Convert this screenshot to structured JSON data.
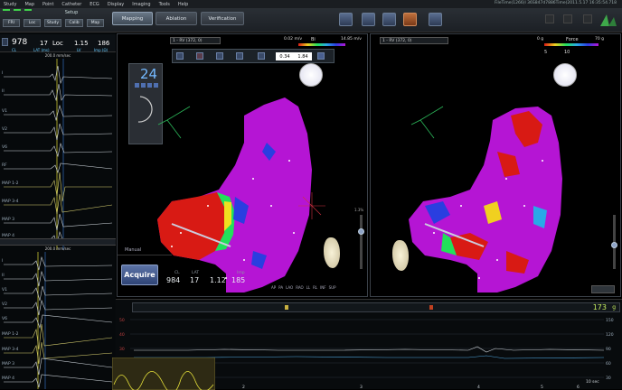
{
  "menu": [
    "Study",
    "Map",
    "Point",
    "Catheter",
    "ECG",
    "Display",
    "Imaging",
    "Tools",
    "Help"
  ],
  "filepath": "FileTime(1266)l 36S847d7886Time(2011.5.17 16:35:54.718",
  "toolbar": {
    "setup_label": "Setup",
    "small_buttons": [
      "FRI",
      "Loc",
      "Study",
      "Calib",
      "Map"
    ],
    "tabs": [
      "Mapping",
      "Ablation",
      "Verification"
    ]
  },
  "left_readout": {
    "cl": "978",
    "cl_label": "CL",
    "lat": "17",
    "lat_label": "LAT (ms)",
    "loc": "Loc",
    "v1": "1.15",
    "v1_label": "LV",
    "v2": "186",
    "v2_label": "Imp (Ω)"
  },
  "ecg_top_speed": "200.0 mm/sec",
  "ecg_bottom_speed": "200.0 mm/sec",
  "ecg_channels_top": [
    "I",
    "II",
    "V1",
    "V2",
    "V6",
    "RF",
    "MAP 1-2",
    "MAP 3-4",
    "MAP 3",
    "MAP 4"
  ],
  "ecg_channels_bottom": [
    "I",
    "II",
    "V1",
    "V2",
    "V6",
    "MAP 1-2",
    "MAP 3-4",
    "MAP 3",
    "MAP 4"
  ],
  "left_map": {
    "dropdown": "1 - RV (372, 0)",
    "scale_min": "0.02 m/v",
    "scale_max": "14.85 m/v",
    "scale_label": "Bi",
    "threshold_left": "0.34",
    "threshold_right": "1.84",
    "number": "24"
  },
  "right_map": {
    "dropdown": "1 - RV (372, 0)",
    "scale_label": "Force",
    "scale_min": "5",
    "scale_max": "10",
    "left_top": "0 g",
    "right_top": "70 g"
  },
  "manual_label": "Manual",
  "acquire_label": "Acquire",
  "point_values": [
    {
      "label": "CL",
      "value": "984"
    },
    {
      "label": "LAT",
      "value": "17"
    },
    {
      "label": "",
      "value": "1.12"
    },
    {
      "label": "Imp",
      "value": "185"
    }
  ],
  "view_buttons": [
    "AP",
    "PA",
    "LAO",
    "RAO",
    "LL",
    "RL",
    "INF",
    "SUP"
  ],
  "slider_label": "1.3%",
  "bottom": {
    "force_value": "173",
    "force_unit": "g",
    "axis_left": [
      "50",
      "40",
      "30",
      "20",
      "10"
    ],
    "axis_right": [
      "150",
      "120",
      "90",
      "60",
      "30"
    ],
    "time_ticks": [
      "1",
      "2",
      "3",
      "4",
      "5",
      "6",
      "10 sec"
    ]
  },
  "colors": {
    "magenta": "#b515d4",
    "red": "#d81a14",
    "green": "#22e05a",
    "accent": "#5a73a8"
  }
}
